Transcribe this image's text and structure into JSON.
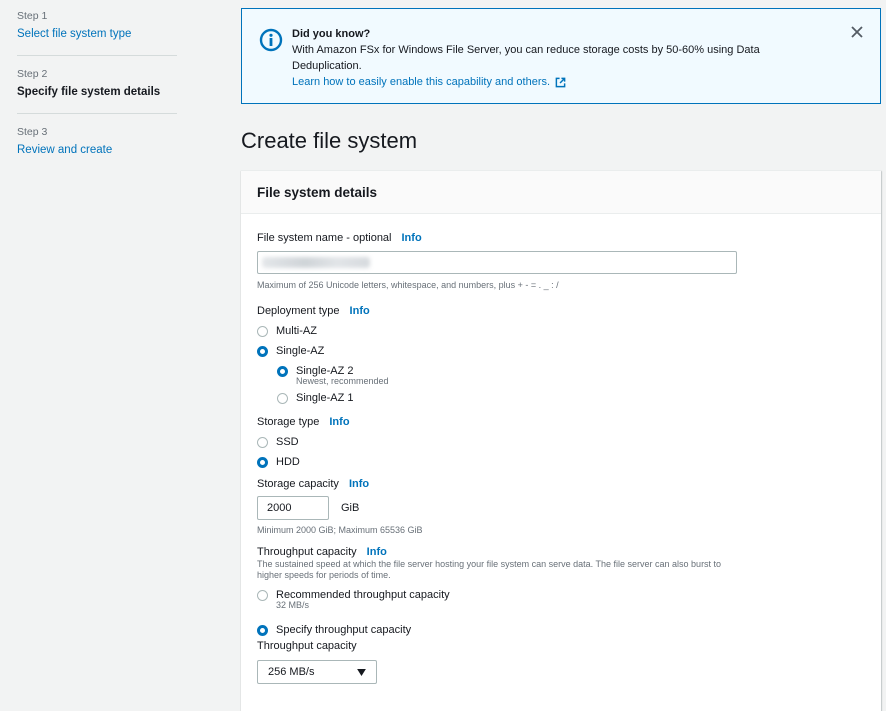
{
  "steps": [
    {
      "num": "Step 1",
      "label": "Select file system type"
    },
    {
      "num": "Step 2",
      "label": "Specify file system details"
    },
    {
      "num": "Step 3",
      "label": "Review and create"
    }
  ],
  "banner": {
    "title": "Did you know?",
    "text": "With Amazon FSx for Windows File Server, you can reduce storage costs by 50-60% using Data Deduplication.",
    "link": "Learn how to easily enable this capability and others."
  },
  "page_title": "Create file system",
  "panel": {
    "header": "File system details",
    "info_label": "Info",
    "name_field": {
      "label": "File system name - optional",
      "hint": "Maximum of 256 Unicode letters, whitespace, and numbers, plus + - = . _ : /"
    },
    "deployment": {
      "label": "Deployment type",
      "options": [
        "Multi-AZ",
        "Single-AZ"
      ],
      "sub_options": [
        "Single-AZ 2",
        "Single-AZ 1"
      ],
      "sub_desc": "Newest, recommended"
    },
    "storage_type": {
      "label": "Storage type",
      "options": [
        "SSD",
        "HDD"
      ]
    },
    "storage_capacity": {
      "label": "Storage capacity",
      "value": "2000",
      "unit": "GiB",
      "hint": "Minimum 2000 GiB; Maximum 65536 GiB"
    },
    "throughput": {
      "label": "Throughput capacity",
      "desc": "The sustained speed at which the file server hosting your file system can serve data. The file server can also burst to higher speeds for periods of time.",
      "opt_recommended": "Recommended throughput capacity",
      "opt_recommended_desc": "32 MB/s",
      "opt_specify": "Specify throughput capacity",
      "select_label": "Throughput capacity",
      "select_value": "256 MB/s"
    }
  },
  "colors": {
    "accent": "#0073bb",
    "banner_bg": "#f1faff",
    "page_bg": "#f2f3f3"
  }
}
